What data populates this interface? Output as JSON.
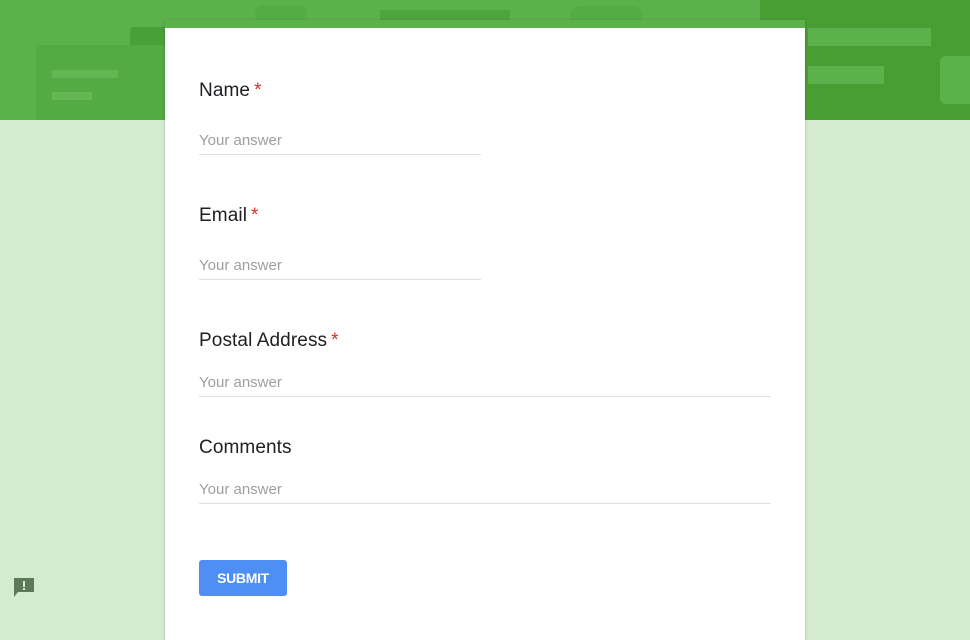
{
  "form": {
    "questions": [
      {
        "label": "Name",
        "required_mark": "*",
        "placeholder": "Your answer"
      },
      {
        "label": "Email",
        "required_mark": "*",
        "placeholder": "Your answer"
      },
      {
        "label": "Postal Address",
        "required_mark": "*",
        "placeholder": "Your answer"
      },
      {
        "label": "Comments",
        "required_mark": "",
        "placeholder": "Your answer"
      }
    ],
    "submit_label": "SUBMIT"
  },
  "colors": {
    "theme": "#5bb14a",
    "background": "#d5ebcf",
    "submit": "#4f8ef5",
    "required": "#d93025"
  },
  "icons": {
    "report": "report-problem-icon"
  }
}
